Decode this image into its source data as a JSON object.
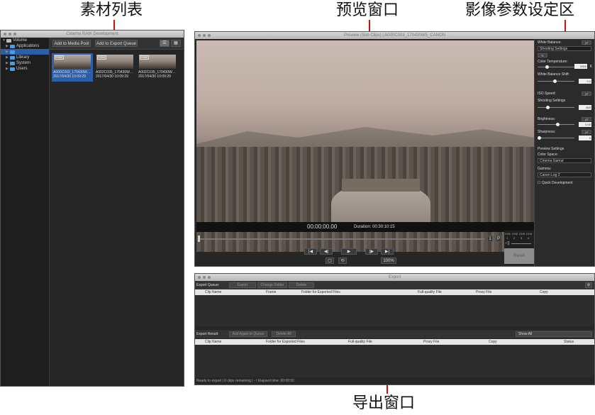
{
  "annotations": {
    "clip_list": "素材列表",
    "preview_window": "预览窗口",
    "image_params": "影像参数设定区",
    "export_window": "导出窗口"
  },
  "browser": {
    "title": "Cinema RAW Development",
    "tree": [
      "Volume",
      "Applications",
      "",
      "Library",
      "System",
      "Users"
    ],
    "add_media_pool": "Add to Media Pool",
    "add_export_queue": "Add to Export Queue",
    "clips": [
      {
        "badge": "RAW",
        "line1": "A000C003_170430W…",
        "line2": "2017/04/30 10:09:29"
      },
      {
        "badge": "RAW",
        "line1": "A002C035_170430W…",
        "line2": "2017/04/30 10:09:29"
      },
      {
        "badge": "RAW",
        "line1": "A002C035_170430W…",
        "line2": "2017/04/30 10:09:29"
      }
    ]
  },
  "preview": {
    "title": "Preview (Sub Clips) | A000C003_170430W5_CANON",
    "timecode": "00:00:00.00",
    "duration": "Duration: 00:30:10:15",
    "transport": [
      "|◀",
      "◀|",
      "▶",
      "|▶",
      "▶|"
    ],
    "zoom": "100%",
    "loop_btns": [
      "1",
      "P"
    ],
    "channels": [
      "CH1",
      "CH2",
      "CH3",
      "CH4"
    ],
    "channel_nums": [
      "1",
      "2",
      "3",
      "4"
    ]
  },
  "settings": {
    "white_balance": "White Balance:",
    "wb_select": "Shooting Settings",
    "color_temp": "Color Temperature:",
    "color_temp_val": "5300",
    "color_temp_unit": "K",
    "wb_shift": "White Balance Shift:",
    "wb_shift_val": "0.0",
    "iso_speed": "ISO Speed:",
    "iso_select": "Shooting Settings",
    "iso_val": "800",
    "brightness": "Brightness:",
    "brightness_val": "0.00",
    "sharpness": "Sharpness:",
    "sharpness_val": "0",
    "preview_settings": "Preview Settings",
    "color_space": "Color Space:",
    "color_space_val": "Cinema Gamut",
    "gamma": "Gamma:",
    "gamma_val": "Canon Log 2",
    "quick_dev": "Quick Development",
    "reset": "Reset"
  },
  "export": {
    "title": "Export",
    "queue_label": "Export Queue:",
    "queue_btns": [
      "Export",
      "Change Folder",
      "Delete"
    ],
    "queue_cols": [
      "Clip Name",
      "Frame",
      "Folder for Exported Files",
      "Full-quality File",
      "Proxy File",
      "Copy"
    ],
    "result_label": "Export Result:",
    "result_btns": [
      "Add Again to Queue",
      "Delete All"
    ],
    "show_all": "Show All",
    "result_cols": [
      "Clip Name",
      "Folder for Exported Files",
      "Full-quality File",
      "Proxy File",
      "Copy",
      "Status"
    ],
    "status": "Ready to export | 0 clips remaining | - / Elapsed time: 00:00:00"
  }
}
